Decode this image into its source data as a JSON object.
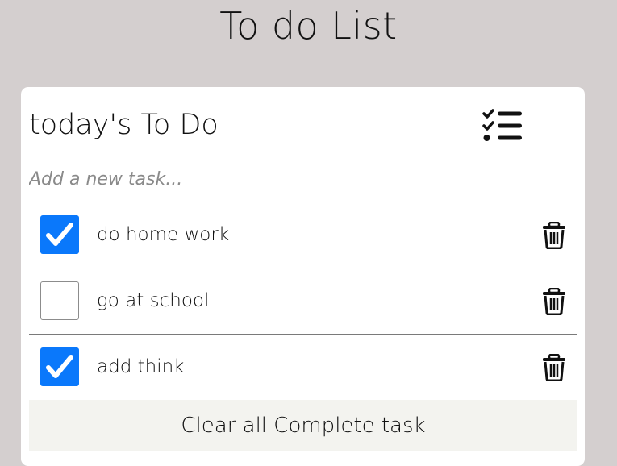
{
  "page": {
    "title": "To do List"
  },
  "card": {
    "title": "today's To Do",
    "header_icon": "checklist-icon"
  },
  "new_task": {
    "placeholder": "Add a new task...",
    "value": ""
  },
  "tasks": [
    {
      "label": "do home work",
      "checked": true
    },
    {
      "label": "go at school",
      "checked": false
    },
    {
      "label": "add think",
      "checked": true
    }
  ],
  "icons": {
    "delete": "trash-icon",
    "check": "checkmark-icon"
  },
  "colors": {
    "background": "#d4cfcf",
    "card": "#ffffff",
    "checked": "#0a78fb",
    "clear_button": "#f3f3ef"
  },
  "clear_button": {
    "label": "Clear all Complete task"
  }
}
